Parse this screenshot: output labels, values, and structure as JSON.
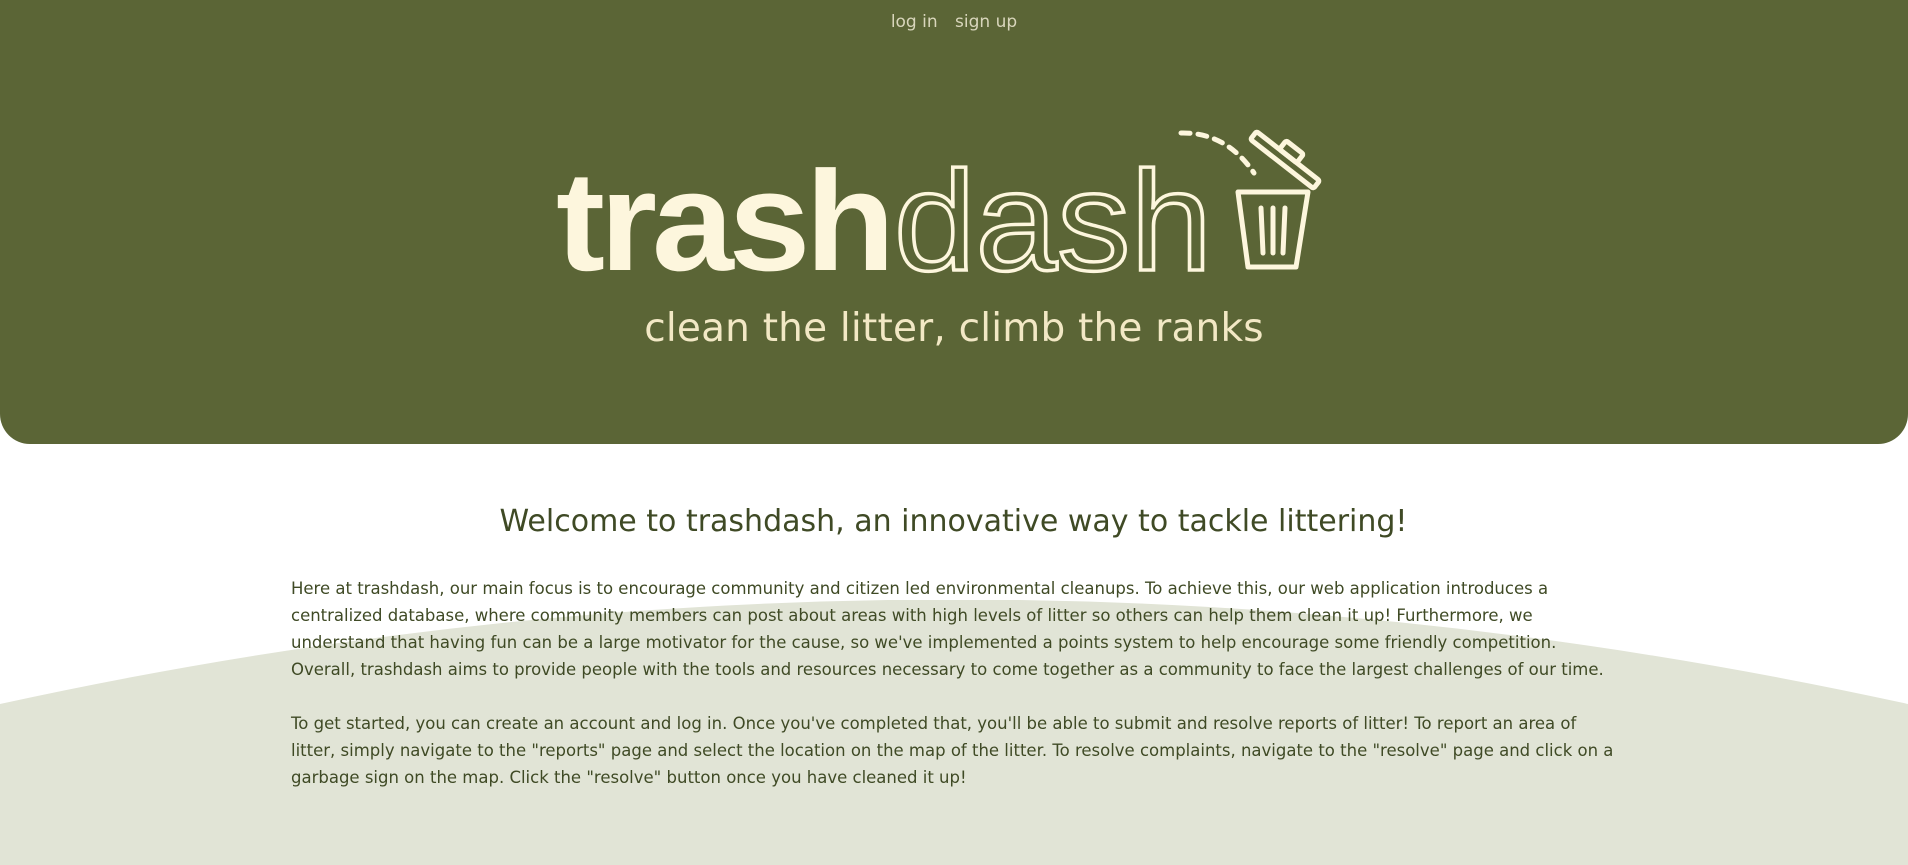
{
  "colors": {
    "hero_bg": "#5b6536",
    "hero_text": "#fdf6dd",
    "tagline": "#f2e8c5",
    "nav_link": "#d9d6bc",
    "body_text": "#3f4a25",
    "arc_bg": "#e1e4d6"
  },
  "nav": {
    "login_label": "log in",
    "signup_label": "sign up"
  },
  "logo": {
    "word_bold": "trash",
    "word_outline": "dash",
    "icon": "trash-can-icon"
  },
  "hero": {
    "tagline": "clean the litter, climb the ranks"
  },
  "main": {
    "welcome": "Welcome to trashdash, an innovative way to tackle littering!",
    "paragraphs": [
      "Here at trashdash, our main focus is to encourage community and citizen led environmental cleanups. To achieve this, our web application introduces a centralized database, where community members can post about areas with high levels of litter so others can help them clean it up! Furthermore, we understand that having fun can be a large motivator for the cause, so we've implemented a points system to help encourage some friendly competition. Overall, trashdash aims to provide people with the tools and resources necessary to come together as a community to face the largest challenges of our time.",
      "To get started, you can create an account and log in. Once you've completed that, you'll be able to submit and resolve reports of litter! To report an area of litter, simply navigate to the \"reports\" page and select the location on the map of the litter. To resolve complaints, navigate to the \"resolve\" page and click on a garbage sign on the map. Click the \"resolve\" button once you have cleaned it up!"
    ]
  }
}
